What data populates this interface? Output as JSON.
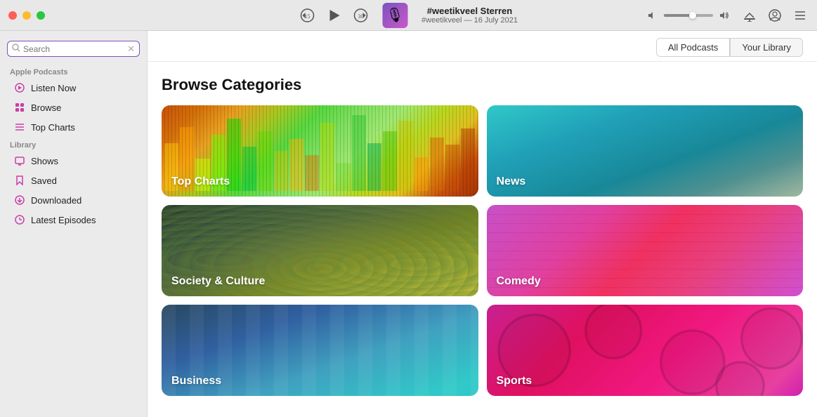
{
  "titlebar": {
    "track_title": "#weetikveel Sterren",
    "track_subtitle": "#weetikveel — 16 July 2021",
    "artwork_emoji": "🎙",
    "rewind_label": "15",
    "fastforward_label": "30"
  },
  "header_tabs": [
    {
      "label": "All Podcasts",
      "active": false
    },
    {
      "label": "Your Library",
      "active": false
    }
  ],
  "sidebar": {
    "section_apple_podcasts": "Apple Podcasts",
    "section_library": "Library",
    "search_placeholder": "Search",
    "items_apple": [
      {
        "id": "listen-now",
        "label": "Listen Now",
        "icon": "▶"
      },
      {
        "id": "browse",
        "label": "Browse",
        "icon": "⊞"
      },
      {
        "id": "top-charts",
        "label": "Top Charts",
        "icon": "☰"
      }
    ],
    "items_library": [
      {
        "id": "shows",
        "label": "Shows",
        "icon": "📺"
      },
      {
        "id": "saved",
        "label": "Saved",
        "icon": "🔖"
      },
      {
        "id": "downloaded",
        "label": "Downloaded",
        "icon": "⊕"
      },
      {
        "id": "latest-episodes",
        "label": "Latest Episodes",
        "icon": "⊕"
      }
    ]
  },
  "content": {
    "browse_title": "Browse Categories",
    "categories": [
      {
        "id": "top-charts",
        "label": "Top Charts",
        "class": "cat-top-charts"
      },
      {
        "id": "news",
        "label": "News",
        "class": "cat-news"
      },
      {
        "id": "society-culture",
        "label": "Society & Culture",
        "class": "cat-society"
      },
      {
        "id": "comedy",
        "label": "Comedy",
        "class": "cat-comedy"
      },
      {
        "id": "business",
        "label": "Business",
        "class": "cat-business"
      },
      {
        "id": "sports",
        "label": "Sports",
        "class": "cat-sports"
      }
    ]
  }
}
